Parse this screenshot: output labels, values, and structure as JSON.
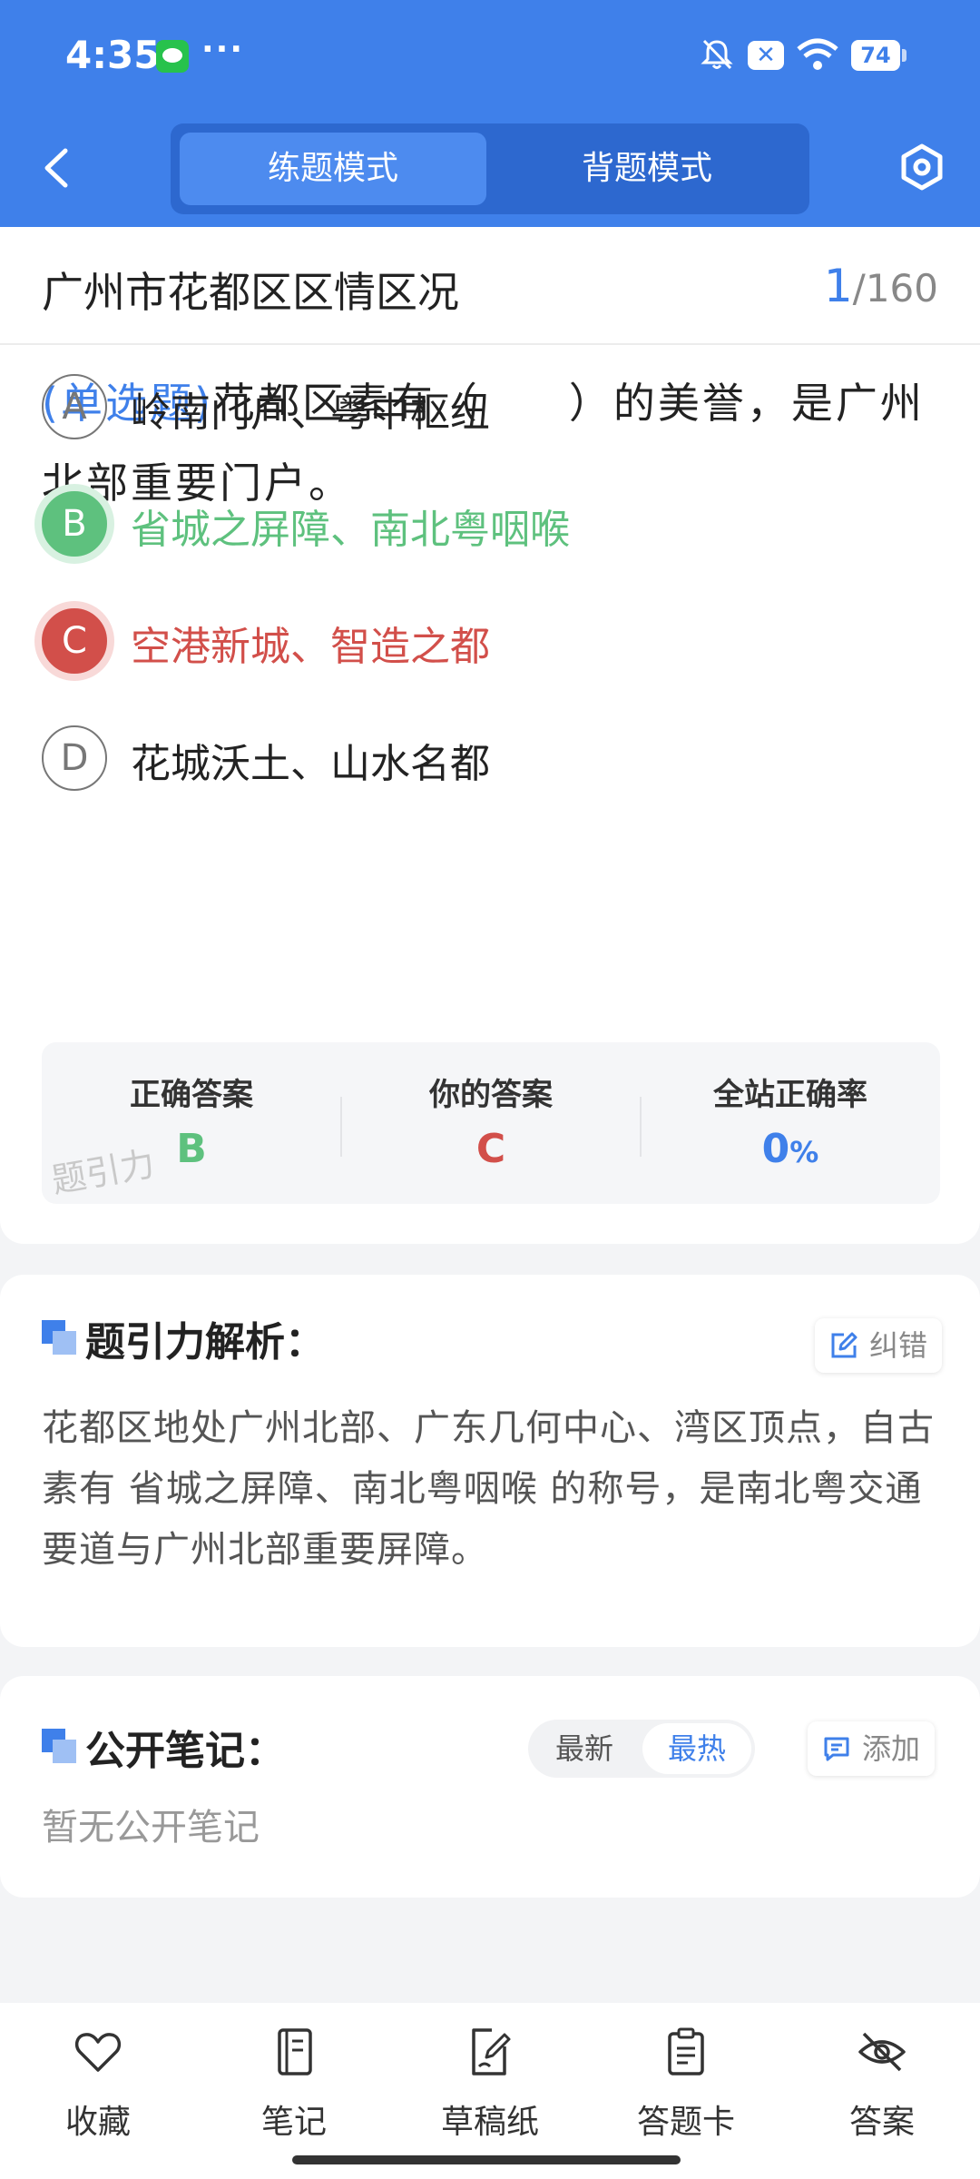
{
  "status_bar": {
    "time": "4:35",
    "dots": "···",
    "battery": "74"
  },
  "header": {
    "modes": [
      "练题模式",
      "背题模式"
    ],
    "active_mode": "练题模式"
  },
  "question_header": {
    "title": "广州市花都区区情区况",
    "current": "1",
    "total": "/160"
  },
  "question": {
    "type": "(单选题)",
    "text": "花都区素有（　　）的美誉，是广州北部重要门户。"
  },
  "options": [
    {
      "letter": "A",
      "text": "岭南门户、粤中枢纽",
      "state": "normal"
    },
    {
      "letter": "B",
      "text": "省城之屏障、南北粤咽喉",
      "state": "correct"
    },
    {
      "letter": "C",
      "text": "空港新城、智造之都",
      "state": "wrong"
    },
    {
      "letter": "D",
      "text": "花城沃土、山水名都",
      "state": "normal"
    }
  ],
  "stats": {
    "correct_label": "正确答案",
    "correct_value": "B",
    "yours_label": "你的答案",
    "yours_value": "C",
    "rate_label": "全站正确率",
    "rate_value": "0",
    "rate_unit": "%",
    "watermark": "题引力"
  },
  "colors": {
    "accent": "#3f80ea",
    "correct": "#5ec17e",
    "wrong": "#d24f4a"
  },
  "analysis": {
    "title": "题引力解析：",
    "report_label": "纠错",
    "text": "花都区地处广州北部、广东几何中心、湾区顶点，自古素有 省城之屏障、南北粤咽喉 的称号，是南北粤交通要道与广州北部重要屏障。"
  },
  "notes": {
    "title": "公开笔记：",
    "sort_latest": "最新",
    "sort_hot": "最热",
    "add_label": "添加",
    "empty_text": "暂无公开笔记"
  },
  "bottom_tabs": [
    {
      "label": "收藏",
      "icon": "heart-icon"
    },
    {
      "label": "笔记",
      "icon": "notebook-icon"
    },
    {
      "label": "草稿纸",
      "icon": "draft-icon"
    },
    {
      "label": "答题卡",
      "icon": "clipboard-icon"
    },
    {
      "label": "答案",
      "icon": "eye-off-icon"
    }
  ]
}
